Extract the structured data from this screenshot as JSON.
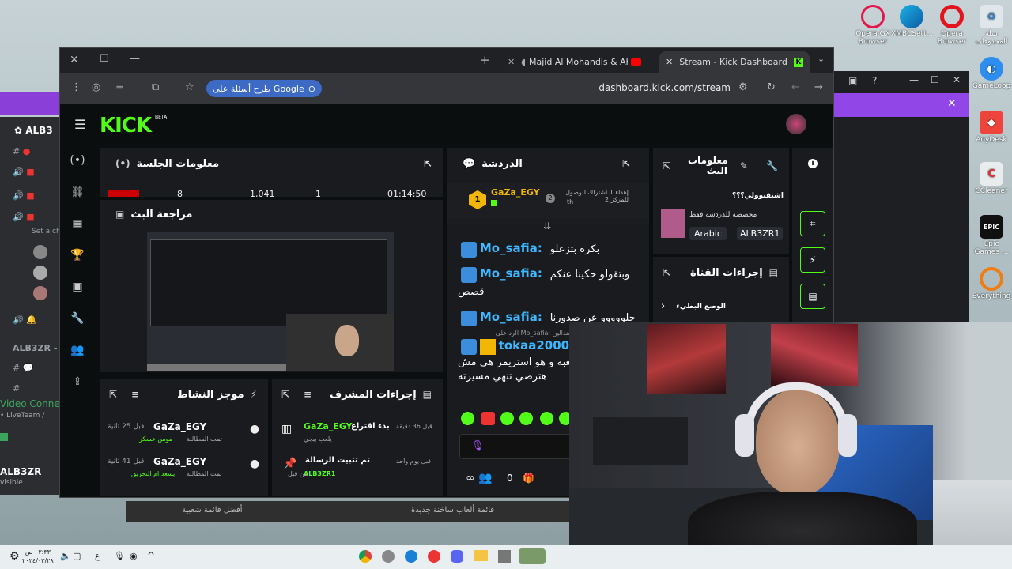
{
  "desktop": {
    "icons": [
      {
        "label": "Opera GX Browser",
        "icon": "opera-gx-icon"
      },
      {
        "label": "XMBCSett...",
        "icon": "edge-icon"
      },
      {
        "label": "Opera Browser",
        "icon": "opera-icon"
      },
      {
        "label": "سلة المحذوفات",
        "icon": "recycle-bin-icon"
      },
      {
        "label": "GameLoop",
        "icon": "gameloop-icon"
      },
      {
        "label": "AnyDesk",
        "icon": "anydesk-icon"
      },
      {
        "label": "CCleaner",
        "icon": "ccleaner-icon"
      },
      {
        "label": "Epic Games ...",
        "icon": "epic-games-icon"
      },
      {
        "label": "Everything",
        "icon": "everything-icon"
      }
    ]
  },
  "discord": {
    "server": "ALB3",
    "channels": [
      "Set a ch",
      "ALB3ZR -"
    ],
    "voice": "Video Connec",
    "voice_sub": "• LiveTeam /",
    "user": "ALB3ZR",
    "user_status": "visible"
  },
  "browser": {
    "tabs": [
      {
        "label": "Majid Al Mohandis & Ahme"
      },
      {
        "label": "Stream - Kick Dashboard"
      }
    ],
    "google_button": "طرح أسئلة على Google",
    "url": "dashboard.kick.com/stream"
  },
  "kick": {
    "logo": "KICK",
    "logo_badge": "BETA",
    "session": {
      "title": "معلومات الجلسة",
      "stats": [
        "8",
        "1,041",
        "1",
        "01:14:50"
      ]
    },
    "preview": {
      "title": "مراجعة البث"
    },
    "chat": {
      "title": "الدردشة",
      "pinned_user": "GaZa_EGY",
      "pinned_count": "1",
      "pinned_text": "إهداء 1 اشتراك للوصول للمركز 2",
      "pinned_rank": "2",
      "pinned_th": "th",
      "messages": [
        {
          "user": "Mo_safia",
          "text": "بكرة بتزعلو"
        },
        {
          "user": "Mo_safia",
          "text": "وبتقولو حكينا عنكم",
          "text2": "قصص"
        },
        {
          "user": "Mo_safia",
          "text": "حلووووو عن صدورنا"
        },
        {
          "reply": "الرد على Mo_safia: يوم سندالين",
          "user": "tokaa2000",
          "text": "لعبه و هو استريمر هي مش",
          "text2": "هترضي تنهي مسيرته"
        }
      ],
      "input_placeholder": "",
      "viewers": "0",
      "infinity": "∞"
    },
    "stream_info": {
      "title": "معلومات البث",
      "stream_title": "اشتقتوولي؟؟؟",
      "category": "مخصصة للدردشة فقط",
      "tags": [
        "Arabic",
        "ALB3ZR1"
      ]
    },
    "channel_actions": {
      "title": "إجراءات القناة",
      "item": "الوضع البطيء"
    },
    "activity": {
      "title": "موجز النشاط",
      "items": [
        {
          "user": "GaZa_EGY",
          "time": "قبل 25 ثانية",
          "sub": "تمت المطالبة",
          "reward": "مومن عسكر"
        },
        {
          "user": "GaZa_EGY",
          "time": "قبل 41 ثانية",
          "sub": "تمت المطالبة",
          "reward": "يسعد ام التحريق"
        }
      ]
    },
    "mod_actions": {
      "title": "إجراءات المشرف",
      "items": [
        {
          "title": "بدء اقتراع",
          "user": "GaZa_EGY",
          "time": "قبل 36 دقيقة",
          "sub": "يلعب ببجي"
        },
        {
          "title": "تم تثبيت الرسالة",
          "user": "ALB3ZR1",
          "time": "قبل يوم واحد",
          "sub": "من قبل"
        }
      ]
    }
  },
  "bottom_strip": {
    "items": [
      "أفضل قائمة شعبية",
      "قائمة ألعاب ساخنة جديدة"
    ]
  },
  "taskbar": {
    "time": "٠٣:٣٣ ص",
    "date": "٢٠٢٤/٠٣/٢٨",
    "lang": "ع"
  },
  "colors": {
    "kick_green": "#53fc18",
    "chat_blue": "#3db7ff",
    "tab_bg": "#202124"
  }
}
